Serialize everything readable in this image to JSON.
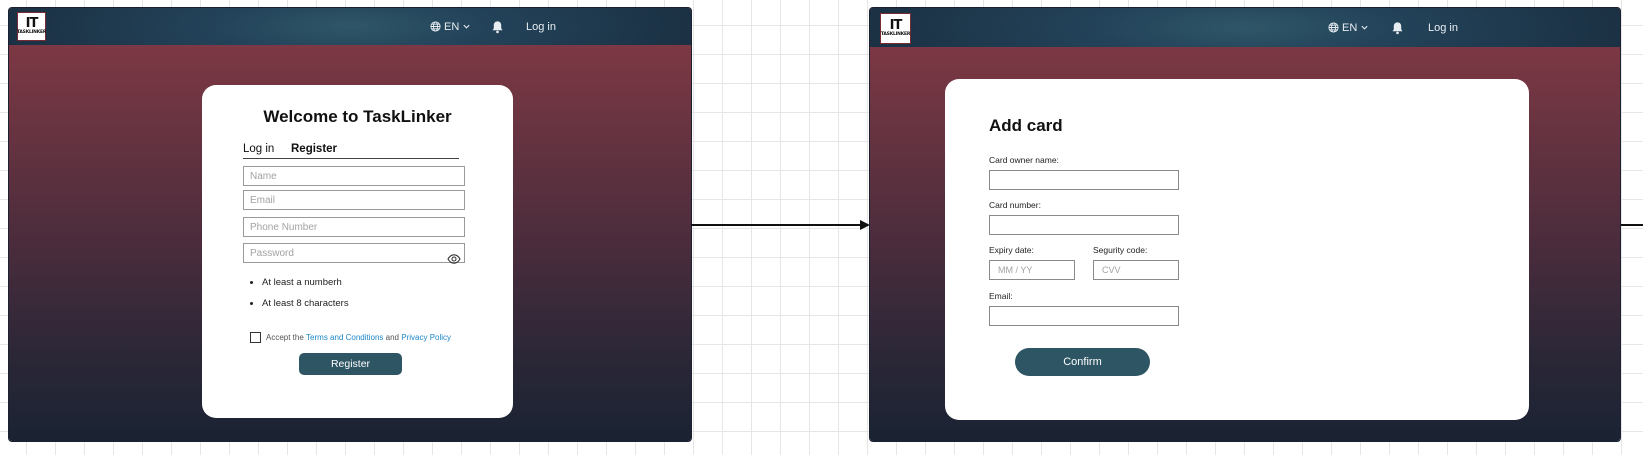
{
  "screen_left": {
    "logo": {
      "mark": "IT",
      "text": "TASKLINKER"
    },
    "nav": {
      "language": "EN",
      "login": "Log in"
    },
    "register_card": {
      "title": "Welcome to TaskLinker",
      "tabs": [
        "Log in",
        "Register"
      ],
      "fields": {
        "name_placeholder": "Name",
        "email_placeholder": "Email",
        "phone_placeholder": "Phone Number",
        "password_placeholder": "Password"
      },
      "password_rules": [
        "At least a numberh",
        "At least 8 characters"
      ],
      "terms": {
        "prefix": "Accept the",
        "terms_link": "Terms and Conditions",
        "and": "and",
        "privacy_link": "Privacy Policy"
      },
      "submit_label": "Register"
    }
  },
  "screen_right": {
    "logo": {
      "mark": "IT",
      "text": "TASKLINKER"
    },
    "nav": {
      "language": "EN",
      "login": "Log in"
    },
    "add_card": {
      "title": "Add card",
      "owner_label": "Card owner name:",
      "number_label": "Card number:",
      "expiry_label": "Expiry date:",
      "expiry_placeholder": "MM / YY",
      "security_label": "Segurity code:",
      "security_placeholder": "CVV",
      "email_label": "Email:",
      "confirm_label": "Confirm"
    }
  },
  "colors": {
    "accent": "#2e5563",
    "link": "#1b86c9",
    "gradient_top": "#853a45",
    "gradient_bottom": "#1a2333"
  }
}
